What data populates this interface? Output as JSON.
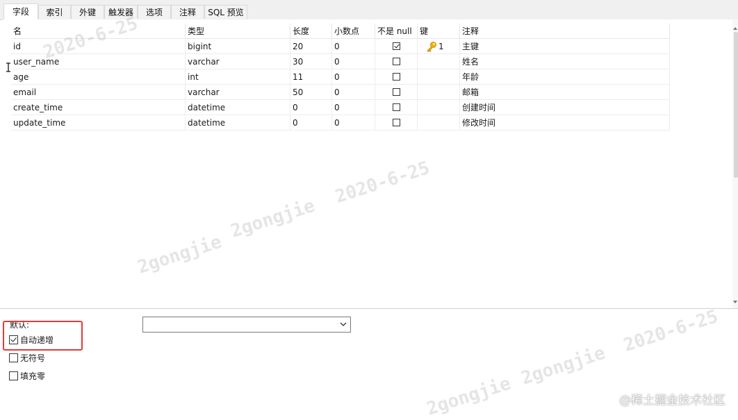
{
  "tabs": [
    {
      "label": "字段",
      "active": true
    },
    {
      "label": "索引"
    },
    {
      "label": "外键"
    },
    {
      "label": "触发器"
    },
    {
      "label": "选项"
    },
    {
      "label": "注释"
    },
    {
      "label": "SQL 预览"
    }
  ],
  "columns": [
    "名",
    "类型",
    "长度",
    "小数点",
    "不是 null",
    "键",
    "注释"
  ],
  "rows": [
    {
      "name": "id",
      "type": "bigint",
      "length": "20",
      "decimals": "0",
      "not_null": true,
      "key": "1",
      "comment": "主键"
    },
    {
      "name": "user_name",
      "type": "varchar",
      "length": "30",
      "decimals": "0",
      "not_null": false,
      "key": "",
      "comment": "姓名"
    },
    {
      "name": "age",
      "type": "int",
      "length": "11",
      "decimals": "0",
      "not_null": false,
      "key": "",
      "comment": "年龄"
    },
    {
      "name": "email",
      "type": "varchar",
      "length": "50",
      "decimals": "0",
      "not_null": false,
      "key": "",
      "comment": "邮箱"
    },
    {
      "name": "create_time",
      "type": "datetime",
      "length": "0",
      "decimals": "0",
      "not_null": false,
      "key": "",
      "comment": "创建时间"
    },
    {
      "name": "update_time",
      "type": "datetime",
      "length": "0",
      "decimals": "0",
      "not_null": false,
      "key": "",
      "comment": "修改时间"
    }
  ],
  "options": {
    "default_label": "默认:",
    "default_value": "",
    "auto_increment": {
      "label": "自动递增",
      "checked": true
    },
    "unsigned": {
      "label": "无符号",
      "checked": false
    },
    "zerofill": {
      "label": "填充零",
      "checked": false
    }
  },
  "watermarks": [
    "2020-6-25",
    "2gongjie"
  ],
  "site_mark": "@稀土掘金技术社区",
  "colors": {
    "highlight": "#e53935",
    "key_icon": "#f2b400"
  }
}
